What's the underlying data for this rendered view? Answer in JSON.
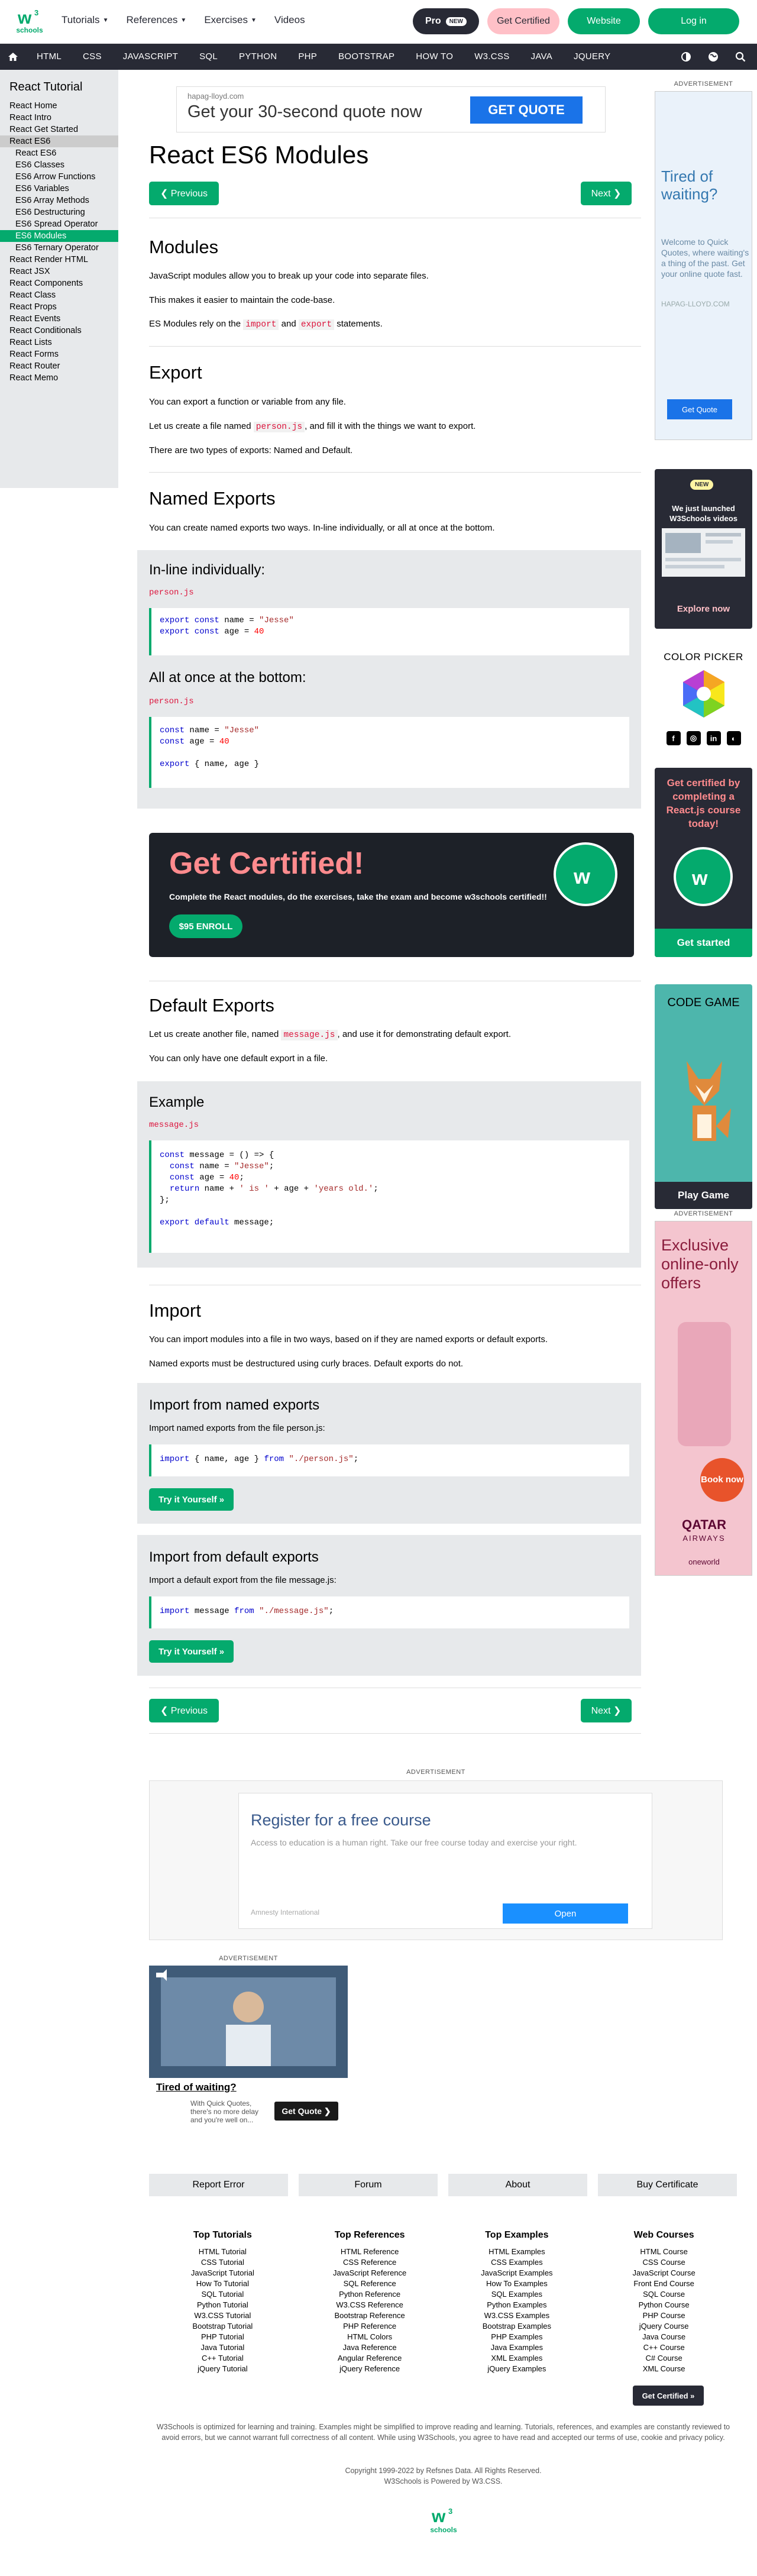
{
  "topbar": {
    "logo_text": "schools",
    "menu": [
      {
        "label": "Tutorials",
        "caret": "▼"
      },
      {
        "label": "References",
        "caret": "▼"
      },
      {
        "label": "Exercises",
        "caret": "▼"
      },
      {
        "label": "Videos",
        "caret": ""
      }
    ],
    "pro_label": "Pro",
    "pro_badge": "NEW",
    "get_certified": "Get Certified",
    "website": "Website",
    "login": "Log in"
  },
  "navbar": {
    "items": [
      "HTML",
      "CSS",
      "JAVASCRIPT",
      "SQL",
      "PYTHON",
      "PHP",
      "BOOTSTRAP",
      "HOW TO",
      "W3.CSS",
      "JAVA",
      "JQUERY"
    ]
  },
  "sidebar": {
    "title": "React Tutorial",
    "items": [
      {
        "label": "React Home",
        "type": "item"
      },
      {
        "label": "React Intro",
        "type": "item"
      },
      {
        "label": "React Get Started",
        "type": "item"
      },
      {
        "label": "React ES6",
        "type": "parent"
      },
      {
        "label": "React ES6",
        "type": "sub"
      },
      {
        "label": "ES6 Classes",
        "type": "sub"
      },
      {
        "label": "ES6 Arrow Functions",
        "type": "sub"
      },
      {
        "label": "ES6 Variables",
        "type": "sub"
      },
      {
        "label": "ES6 Array Methods",
        "type": "sub"
      },
      {
        "label": "ES6 Destructuring",
        "type": "sub"
      },
      {
        "label": "ES6 Spread Operator",
        "type": "sub"
      },
      {
        "label": "ES6 Modules",
        "type": "active"
      },
      {
        "label": "ES6 Ternary Operator",
        "type": "sub"
      },
      {
        "label": "React Render HTML",
        "type": "item"
      },
      {
        "label": "React JSX",
        "type": "item"
      },
      {
        "label": "React Components",
        "type": "item"
      },
      {
        "label": "React Class",
        "type": "item"
      },
      {
        "label": "React Props",
        "type": "item"
      },
      {
        "label": "React Events",
        "type": "item"
      },
      {
        "label": "React Conditionals",
        "type": "item"
      },
      {
        "label": "React Lists",
        "type": "item"
      },
      {
        "label": "React Forms",
        "type": "item"
      },
      {
        "label": "React Router",
        "type": "item"
      },
      {
        "label": "React Memo",
        "type": "item"
      }
    ]
  },
  "top_ad": {
    "source": "hapag-lloyd.com",
    "headline": "Get your 30-second quote now",
    "button": "GET QUOTE"
  },
  "main": {
    "title": "React ES6 Modules",
    "prev": "❮ Previous",
    "next": "Next ❯",
    "modules": {
      "heading": "Modules",
      "p1": "JavaScript modules allow you to break up your code into separate files.",
      "p2": "This makes it easier to maintain the code-base.",
      "p3_pre": "ES Modules rely on the ",
      "p3_code1": "import",
      "p3_mid": " and ",
      "p3_code2": "export",
      "p3_post": " statements."
    },
    "export": {
      "heading": "Export",
      "p1": "You can export a function or variable from any file.",
      "p2_pre": "Let us create a file named ",
      "p2_code": "person.js",
      "p2_post": ", and fill it with the things we want to export.",
      "p3": "There are two types of exports: Named and Default."
    },
    "named": {
      "heading": "Named Exports",
      "p1": "You can create named exports two ways. In-line individually, or all at once at the bottom.",
      "inline_heading": "In-line individually:",
      "inline_file": "person.js",
      "bottom_heading": "All at once at the bottom:",
      "bottom_file": "person.js"
    },
    "cert_banner": {
      "title": "Get Certified!",
      "subtitle": "Complete the React modules, do the exercises, take the exam and become w3schools certified!!",
      "button": "$95 ENROLL"
    },
    "default": {
      "heading": "Default Exports",
      "p1_pre": "Let us create another file, named ",
      "p1_code": "message.js",
      "p1_post": ", and use it for demonstrating default export.",
      "p2": "You can only have one default export in a file.",
      "example_heading": "Example",
      "example_file": "message.js"
    },
    "import": {
      "heading": "Import",
      "p1": "You can import modules into a file in two ways, based on if they are named exports or default exports.",
      "p2": "Named exports must be destructured using curly braces. Default exports do not.",
      "named_heading": "Import from named exports",
      "named_desc": "Import named exports from the file person.js:",
      "default_heading": "Import from default exports",
      "default_desc": "Import a default export from the file message.js:",
      "try": "Try it Yourself »"
    }
  },
  "right": {
    "ad_label": "ADVERTISEMENT",
    "ad1": {
      "headline": "Tired of waiting?",
      "text": "Welcome to Quick Quotes, where waiting's a thing of the past. Get your online quote fast.",
      "source": "HAPAG-LLOYD.COM",
      "button": "Get Quote"
    },
    "yt": {
      "badge": "NEW",
      "text": "We just launched W3Schools videos",
      "button": "Explore now"
    },
    "color_picker": "COLOR PICKER",
    "cert": {
      "text": "Get certified by completing a React.js course today!",
      "button": "Get started"
    },
    "code_game": {
      "title": "CODE GAME",
      "button": "Play Game"
    },
    "ad3": {
      "headline": "Exclusive online-only offers",
      "book": "Book now",
      "brand": "QATAR",
      "brand2": "AIRWAYS",
      "alliance": "oneworld"
    }
  },
  "bottom_ads": {
    "label": "ADVERTISEMENT",
    "ad4": {
      "headline": "Register for a free course",
      "text": "Access to education is a human right. Take our free course today and exercise your right.",
      "source": "Amnesty International",
      "button": "Open"
    },
    "ad5": {
      "headline": "Tired of waiting?",
      "text": "With Quick Quotes, there's no more delay and you're well on...",
      "button": "Get Quote ❯"
    }
  },
  "footer": {
    "buttons": [
      "Report Error",
      "Forum",
      "About",
      "Buy Certificate"
    ],
    "columns": [
      {
        "heading": "Top Tutorials",
        "links": [
          "HTML Tutorial",
          "CSS Tutorial",
          "JavaScript Tutorial",
          "How To Tutorial",
          "SQL Tutorial",
          "Python Tutorial",
          "W3.CSS Tutorial",
          "Bootstrap Tutorial",
          "PHP Tutorial",
          "Java Tutorial",
          "C++ Tutorial",
          "jQuery Tutorial"
        ]
      },
      {
        "heading": "Top References",
        "links": [
          "HTML Reference",
          "CSS Reference",
          "JavaScript Reference",
          "SQL Reference",
          "Python Reference",
          "W3.CSS Reference",
          "Bootstrap Reference",
          "PHP Reference",
          "HTML Colors",
          "Java Reference",
          "Angular Reference",
          "jQuery Reference"
        ]
      },
      {
        "heading": "Top Examples",
        "links": [
          "HTML Examples",
          "CSS Examples",
          "JavaScript Examples",
          "How To Examples",
          "SQL Examples",
          "Python Examples",
          "W3.CSS Examples",
          "Bootstrap Examples",
          "PHP Examples",
          "Java Examples",
          "XML Examples",
          "jQuery Examples"
        ]
      },
      {
        "heading": "Web Courses",
        "links": [
          "HTML Course",
          "CSS Course",
          "JavaScript Course",
          "Front End Course",
          "SQL Course",
          "Python Course",
          "PHP Course",
          "jQuery Course",
          "Java Course",
          "C++ Course",
          "C# Course",
          "XML Course"
        ]
      }
    ],
    "get_certified": "Get Certified »",
    "disclaimer": "W3Schools is optimized for learning and training. Examples might be simplified to improve reading and learning. Tutorials, references, and examples are constantly reviewed to avoid errors, but we cannot warrant full correctness of all content. While using W3Schools, you agree to have read and accepted our terms of use, cookie and privacy policy.",
    "copyright": "Copyright 1999-2022 by Refsnes Data. All Rights Reserved.",
    "powered": "W3Schools is Powered by W3.CSS.",
    "logo_text": "schools"
  }
}
